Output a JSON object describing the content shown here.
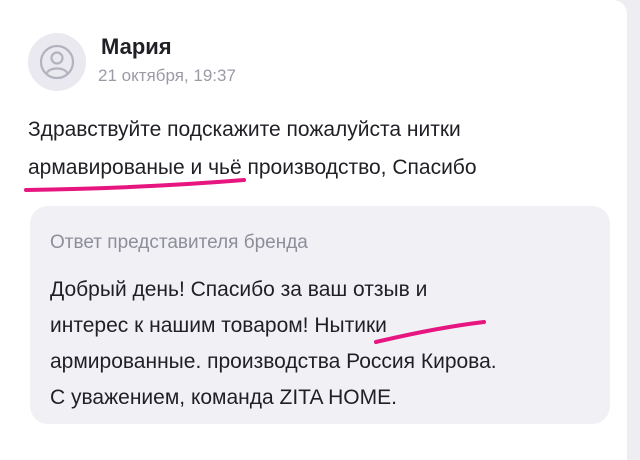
{
  "review": {
    "author_name": "Мария",
    "date": "21 октября, 19:37",
    "text_lines": [
      "Здравствуйте подскажите пожалуйста нитки",
      "армавированые и чьё производство, Спасибо"
    ]
  },
  "brand_reply": {
    "title": "Ответ представителя бренда",
    "text_lines": [
      "Добрый день! Спасибо за ваш отзыв и",
      "интерес к нашим товаром! Нытики",
      "армированные. производства Россия Кирова.",
      "С уважением, команда ZITA HOME."
    ]
  },
  "colors": {
    "highlight_marker": "#e6157f",
    "page_background": "#ededf2",
    "card_background": "#ffffff",
    "reply_background": "#f0f0f5"
  },
  "icons": {
    "avatar": "user-avatar-icon"
  }
}
